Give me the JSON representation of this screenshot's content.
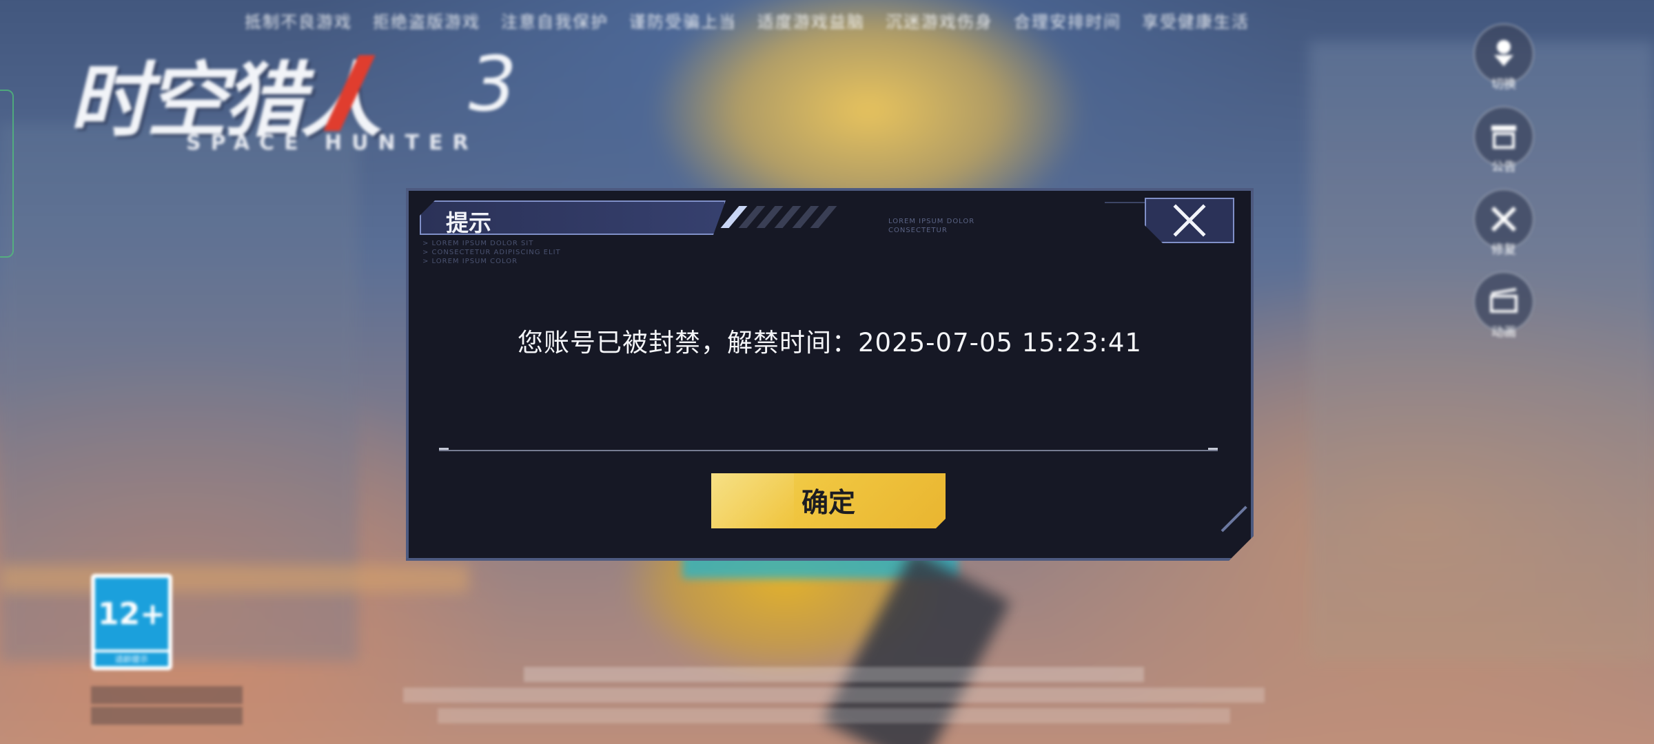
{
  "background": {
    "notice_items": [
      "抵制不良游戏",
      "拒绝盗版游戏",
      "注意自我保护",
      "谨防受骗上当",
      "适度游戏益脑",
      "沉迷游戏伤身",
      "合理安排时间",
      "享受健康生活"
    ],
    "logo": {
      "title": "时空猎人",
      "number": "3",
      "subtitle": "SPACE HUNTER"
    },
    "side_buttons": [
      {
        "icon": "download-icon",
        "label": "切换"
      },
      {
        "icon": "notice-icon",
        "label": "公告"
      },
      {
        "icon": "tools-icon",
        "label": "修复"
      },
      {
        "icon": "video-icon",
        "label": "动画"
      }
    ],
    "age_rating": {
      "label": "12+",
      "caption": "适龄提示"
    }
  },
  "dialog": {
    "title": "提示",
    "deco_right_lines": [
      "LOREM IPSUM DOLOR",
      "CONSECTETUR"
    ],
    "deco_left_lines": [
      "> LOREM IPSUM DOLOR SIT",
      "> CONSECTETUR ADIPISCING ELIT",
      "> LOREM IPSUM COLOR"
    ],
    "message": "您账号已被封禁，解禁时间：2025-07-05  15:23:41",
    "confirm_label": "确定",
    "close_icon": "close-icon"
  },
  "colors": {
    "dialog_bg": "#161825",
    "dialog_border": "#4d5a80",
    "confirm_bg": "#f0c640",
    "title_bar_bg": "#2b3258"
  }
}
